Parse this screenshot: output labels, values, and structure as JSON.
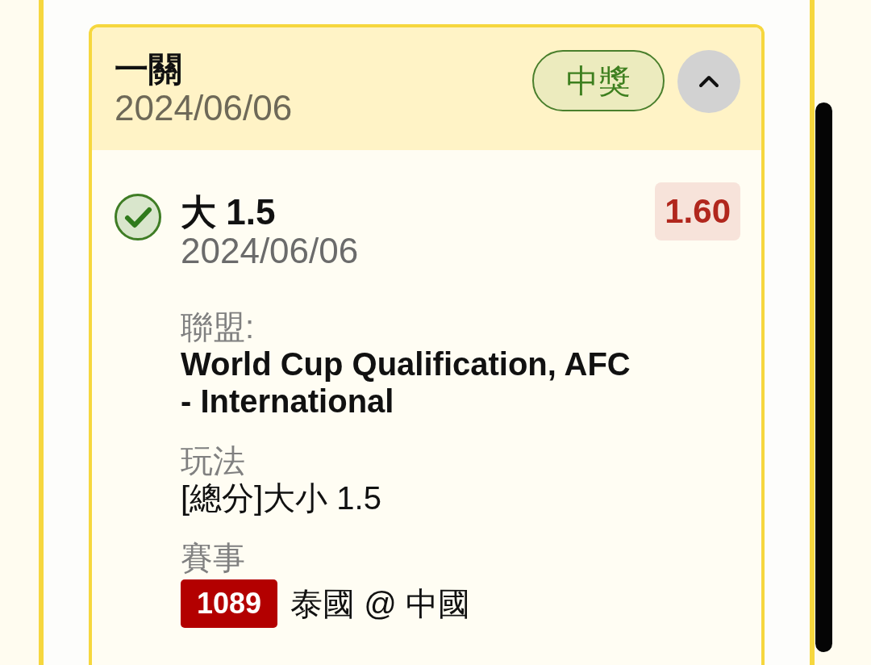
{
  "bet": {
    "title": "一關",
    "date": "2024/06/06",
    "status": {
      "label": "中獎",
      "kind": "won"
    },
    "expanded": true,
    "selections": [
      {
        "won": true,
        "selection": "大 1.5",
        "date": "2024/06/06",
        "odds": "1.60",
        "fields": [
          {
            "kind": "strong",
            "label": "聯盟:",
            "value": "World Cup Qualification, AFC - International"
          },
          {
            "kind": "plain",
            "label": "玩法",
            "value": "[總分]大小 1.5"
          },
          {
            "kind": "match",
            "label": "賽事",
            "match_no": "1089",
            "value": "泰國 @ 中國"
          }
        ]
      }
    ]
  }
}
